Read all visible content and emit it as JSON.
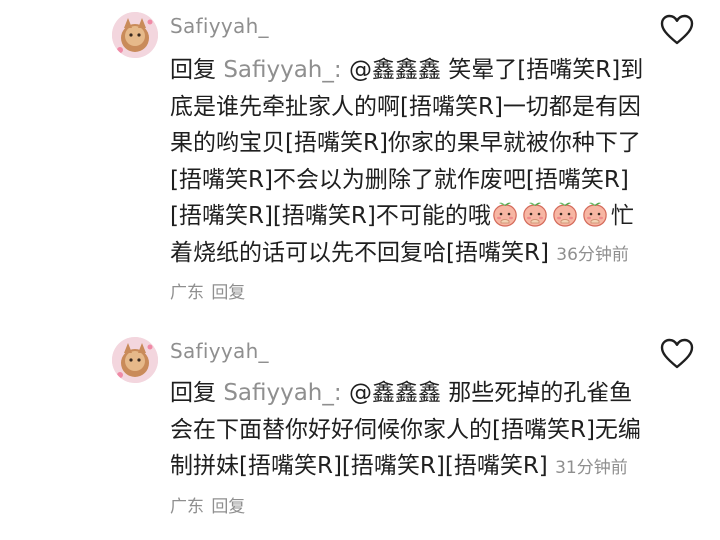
{
  "comments": [
    {
      "username": "Safiyyah_",
      "reply_prefix": "回复",
      "reply_to": "Safiyyah_",
      "reply_sep": ":",
      "mention": "@鑫鑫鑫",
      "text_part1": "笑晕了[捂嘴笑R]到底是谁先牵扯家人的啊[捂嘴笑R]一切都是有因果的哟宝贝[捂嘴笑R]你家的果早就被你种下了[捂嘴笑R]不会以为删除了就作废吧[捂嘴笑R][捂嘴笑R][捂嘴笑R]不可能的哦",
      "emoji_count": 4,
      "emoji_name": "peach-emoji",
      "text_part2": "忙着烧纸的话可以先不回复哈[捂嘴笑R]",
      "time": "36分钟前",
      "location": "广东",
      "reply_label": "回复",
      "like_icon": "heart-outline-icon"
    },
    {
      "username": "Safiyyah_",
      "reply_prefix": "回复",
      "reply_to": "Safiyyah_",
      "reply_sep": ":",
      "mention": "@鑫鑫鑫",
      "text_part1": "那些死掉的孔雀鱼会在下面替你好好伺候你家人的[捂嘴笑R]无编制拼妹[捂嘴笑R][捂嘴笑R][捂嘴笑R]",
      "time": "31分钟前",
      "location": "广东",
      "reply_label": "回复",
      "like_icon": "heart-outline-icon"
    }
  ],
  "colors": {
    "text": "#1f1f1f",
    "muted": "#8f8f8f",
    "background": "#ffffff"
  }
}
